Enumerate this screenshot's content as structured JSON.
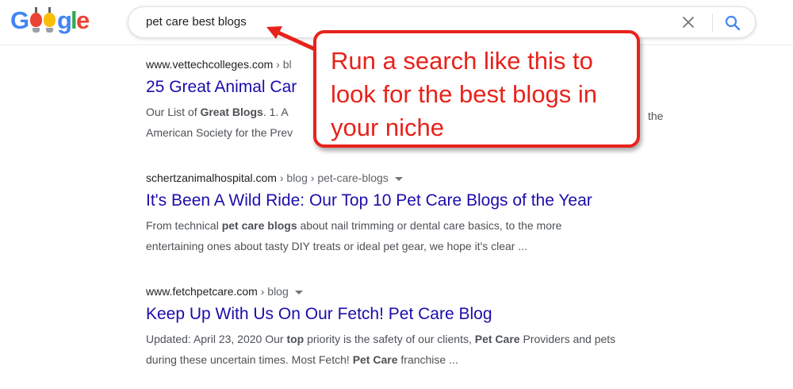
{
  "colors": {
    "link": "#1a0dab",
    "snippet": "#4d5156",
    "cite": "#202124",
    "breadcrumb": "#5f6368",
    "callout": "#e8221b",
    "google_blue": "#4285F4",
    "google_red": "#EA4335",
    "google_yellow": "#FBBC05",
    "google_green": "#34A853"
  },
  "header": {
    "logo_letters": [
      "G",
      "g",
      "l",
      "e"
    ],
    "search": {
      "value": "pet care best blogs",
      "clear_icon": "close-icon",
      "submit_icon": "search-icon"
    }
  },
  "results": [
    {
      "domain": "www.vettechcolleges.com",
      "path": " › bl",
      "title": "25 Great Animal Car",
      "snippet_lines": [
        [
          "Our List of ",
          "Great Blogs",
          ". 1. A"
        ],
        [
          "American Society for the Prev"
        ]
      ],
      "snippet_tail": "the"
    },
    {
      "domain": "schertzanimalhospital.com",
      "path": " › blog › pet-care-blogs",
      "title": "It's Been A Wild Ride: Our Top 10 Pet Care Blogs of the Year",
      "snippet_lines": [
        [
          "From technical ",
          "pet care blogs",
          " about nail trimming or dental care basics, to the more"
        ],
        [
          "entertaining ones about tasty DIY treats or ideal pet gear, we hope it's clear  ..."
        ]
      ]
    },
    {
      "domain": "www.fetchpetcare.com",
      "path": " › blog",
      "title": "Keep Up With Us On Our Fetch! Pet Care Blog",
      "snippet_lines": [
        [
          "Updated: April 23, 2020 Our ",
          "top",
          " priority is the safety of our clients, ",
          "Pet Care",
          " Providers and pets"
        ],
        [
          "during these uncertain times. Most Fetch! ",
          "Pet Care",
          " franchise ..."
        ]
      ]
    }
  ],
  "callout": {
    "lines": [
      "Run a search like this to",
      "look for the best blogs in",
      "your niche"
    ]
  }
}
